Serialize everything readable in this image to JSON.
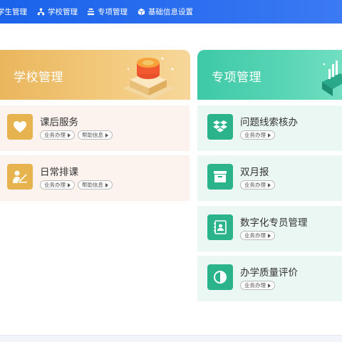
{
  "nav": {
    "items": [
      {
        "label": "学生管理",
        "icon": "student-icon"
      },
      {
        "label": "学校管理",
        "icon": "org-tree-icon"
      },
      {
        "label": "专项管理",
        "icon": "layers-icon"
      },
      {
        "label": "基础信息设置",
        "icon": "cube-icon"
      }
    ]
  },
  "school": {
    "title": "学校管理",
    "items": [
      {
        "title": "课后服务",
        "icon": "heart-icon",
        "pills": [
          "业务办理",
          "帮助信息"
        ]
      },
      {
        "title": "日常排课",
        "icon": "teacher-icon",
        "pills": [
          "业务办理",
          "帮助信息"
        ]
      }
    ]
  },
  "special": {
    "title": "专项管理",
    "items": [
      {
        "title": "问题线索核办",
        "icon": "dropbox-icon",
        "pills": [
          "业务办理"
        ]
      },
      {
        "title": "双月报",
        "icon": "archive-icon",
        "pills": [
          "业务办理"
        ]
      },
      {
        "title": "数字化专员管理",
        "icon": "contact-book-icon",
        "pills": [
          "业务办理"
        ]
      },
      {
        "title": "办学质量评价",
        "icon": "half-circle-icon",
        "pills": [
          "业务办理"
        ]
      }
    ]
  },
  "colors": {
    "nav_bg": "#1a63ea",
    "school_accent": "#e7b34f",
    "special_accent": "#2bb38b"
  }
}
